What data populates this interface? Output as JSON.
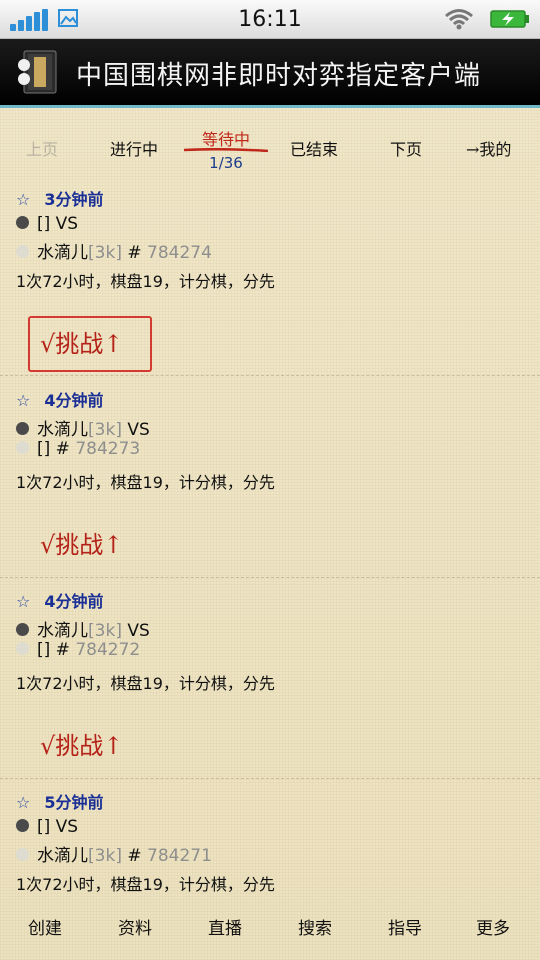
{
  "status_bar": {
    "time": "16:11",
    "signal_icon": "signal-bars-icon",
    "picture_icon": "picture-icon",
    "wifi_icon": "wifi-icon",
    "battery_icon": "battery-charging-icon"
  },
  "app": {
    "title": "中国围棋网非即时对弈指定客户端",
    "logo_icon": "go-board-book-icon"
  },
  "tabs": {
    "prev_page": "上页",
    "in_progress": "进行中",
    "waiting": "等待中",
    "waiting_count": "1/36",
    "finished": "已结束",
    "next_page": "下页",
    "mine": "→我的"
  },
  "games": [
    {
      "time": "3分钟前",
      "black_name": "[]",
      "black_rank": "",
      "white_name": "水滴儿",
      "white_rank": "3k",
      "vs": "VS",
      "game_id": "784274",
      "rules": "1次72小时，棋盘19，计分棋，分先",
      "challenge": "√挑战↑"
    },
    {
      "time": "4分钟前",
      "black_name": "水滴儿",
      "black_rank": "3k",
      "white_name": "[]",
      "white_rank": "",
      "vs": "VS",
      "game_id": "784273",
      "rules": "1次72小时，棋盘19，计分棋，分先",
      "challenge": "√挑战↑"
    },
    {
      "time": "4分钟前",
      "black_name": "水滴儿",
      "black_rank": "3k",
      "white_name": "[]",
      "white_rank": "",
      "vs": "VS",
      "game_id": "784272",
      "rules": "1次72小时，棋盘19，计分棋，分先",
      "challenge": "√挑战↑"
    },
    {
      "time": "5分钟前",
      "black_name": "[]",
      "black_rank": "",
      "white_name": "水滴儿",
      "white_rank": "3k",
      "vs": "VS",
      "game_id": "784271",
      "rules": "1次72小时，棋盘19，计分棋，分先",
      "challenge": ""
    }
  ],
  "bottom_nav": {
    "create": "创建",
    "profile": "资料",
    "live": "直播",
    "search": "搜索",
    "guide": "指导",
    "more": "更多"
  }
}
